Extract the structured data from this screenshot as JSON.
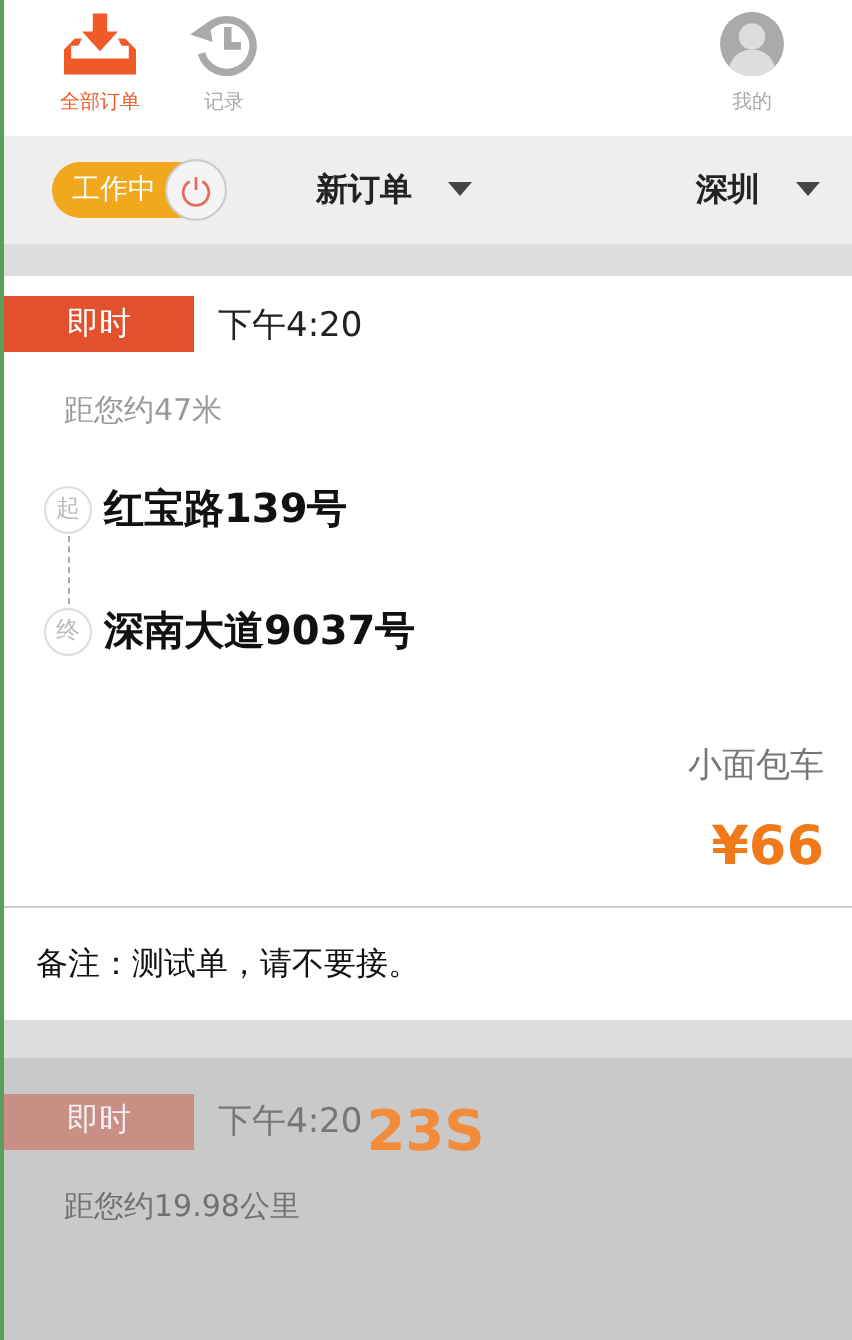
{
  "tabs": [
    {
      "label": "全部订单",
      "kind": "download",
      "selected": true
    },
    {
      "label": "记录",
      "kind": "history",
      "selected": false
    },
    {
      "label": "我的",
      "kind": "profile",
      "selected": false
    }
  ],
  "work_switch": {
    "label": "工作中",
    "on": true
  },
  "filters": [
    {
      "label": "新订单"
    },
    {
      "label": "深圳"
    }
  ],
  "orders": [
    {
      "type": "即时",
      "time": "下午4:20",
      "distance": "距您约47米",
      "start_mark": "起",
      "start": "红宝路139号",
      "end_mark": "终",
      "end": "深南大道9037号",
      "vehicle": "小面包车",
      "price": "¥66",
      "note": "备注：测试单，请不要接。",
      "dimmed": false
    },
    {
      "type": "即时",
      "time": "下午4:20",
      "countdown": "23S",
      "distance": "距您约19.98公里",
      "dimmed": true
    }
  ]
}
